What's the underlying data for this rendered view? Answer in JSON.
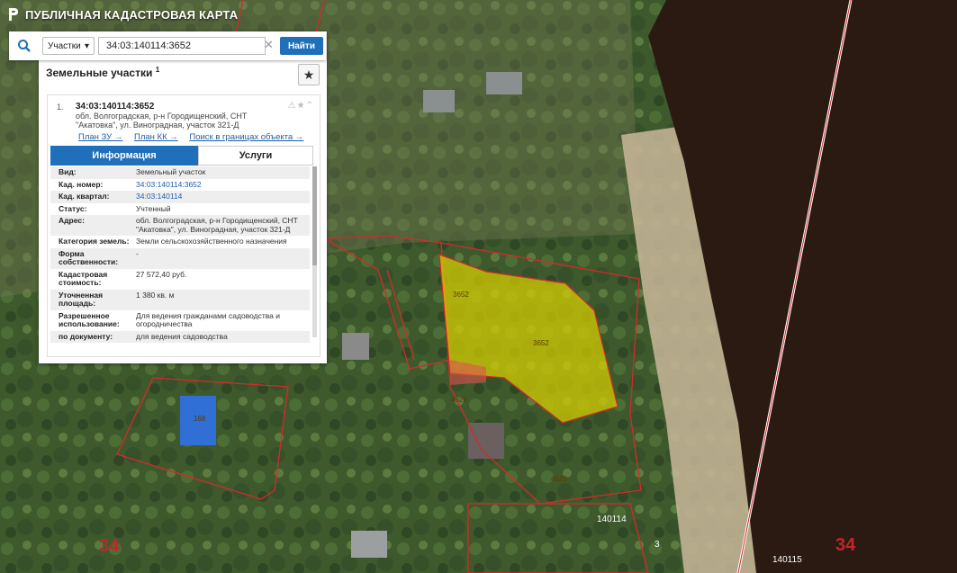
{
  "app": {
    "title": "ПУБЛИЧНАЯ КАДАСТРОВАЯ КАРТА"
  },
  "search": {
    "category": "Участки",
    "value": "34:03:140114:3652",
    "button": "Найти"
  },
  "panel": {
    "section_title": "Земельные участки",
    "section_count": "1",
    "item": {
      "number": "1.",
      "cad_number": "34:03:140114:3652",
      "address": "обл. Волгоградская, р-н Городищенский, СНТ \"Акатовка\", ул. Виноградная, участок 321-Д",
      "links": [
        "План ЗУ →",
        "План КК →",
        "Поиск в границах объекта →"
      ],
      "tabs": [
        "Информация",
        "Услуги"
      ],
      "rows": [
        {
          "key": "Вид:",
          "value": "Земельный участок"
        },
        {
          "key": "Кад. номер:",
          "value": "34:03:140114:3652"
        },
        {
          "key": "Кад. квартал:",
          "value": "34:03:140114"
        },
        {
          "key": "Статус:",
          "value": "Учтенный"
        },
        {
          "key": "Адрес:",
          "value": "обл. Волгоградская, р-н Городищенский, СНТ \"Акатовка\", ул. Виноградная, участок 321-Д"
        },
        {
          "key": "Категория земель:",
          "value": "Земли сельскохозяйственного назначения"
        },
        {
          "key": "Форма собственности:",
          "value": "-"
        },
        {
          "key": "Кадастровая стоимость:",
          "value": "27 572,40 руб."
        },
        {
          "key": "Уточненная площадь:",
          "value": "1 380 кв. м"
        },
        {
          "key": "Разрешенное использование:",
          "value": "Для ведения гражданами садоводства и огородничества"
        },
        {
          "key": "по документу:",
          "value": "для ведения садоводства"
        }
      ]
    }
  },
  "map": {
    "parcel_labels": [
      "3652",
      "3652",
      "4629",
      "4629",
      "168"
    ],
    "quarter_labels": [
      "140114",
      "140115",
      "3"
    ],
    "region_labels": [
      "34",
      "34"
    ],
    "colors": {
      "selected_fill": "#d8d000",
      "boundary": "#d42a2a",
      "water": "#2a1a12"
    }
  }
}
